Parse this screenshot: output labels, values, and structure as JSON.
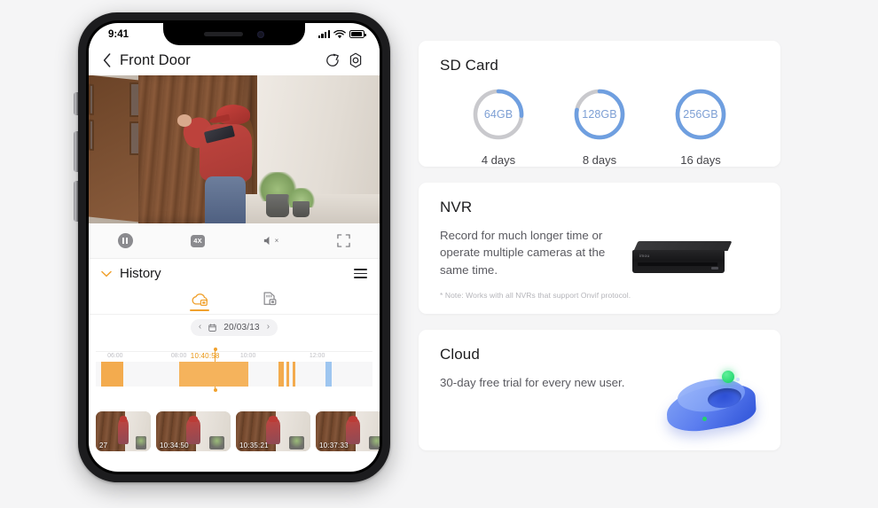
{
  "phone": {
    "status_bar": {
      "time": "9:41",
      "signal_icon": "cellular-bars-icon",
      "wifi_icon": "wifi-icon",
      "battery_icon": "battery-icon"
    },
    "header": {
      "back_icon": "chevron-left-icon",
      "title": "Front Door",
      "share_icon": "share-icon",
      "settings_icon": "settings-gear-icon"
    },
    "video": {
      "scene_description": "Front door camera live view",
      "person": "delivery person at wooden door"
    },
    "controls": [
      {
        "name": "pause-button",
        "icon": "pause-icon",
        "label": ""
      },
      {
        "name": "playback-speed-button",
        "icon": "speed-badge-icon",
        "label": "4X"
      },
      {
        "name": "mute-button",
        "icon": "speaker-mute-icon",
        "label": "×"
      },
      {
        "name": "fullscreen-button",
        "icon": "fullscreen-icon",
        "label": ""
      }
    ],
    "history": {
      "chevron_icon": "chevron-down-icon",
      "title": "History",
      "menu_icon": "hamburger-menu-icon",
      "tabs": [
        {
          "name": "cloud-storage-tab",
          "icon": "cloud-video-icon",
          "active": true
        },
        {
          "name": "sd-card-tab",
          "icon": "sd-card-video-icon",
          "active": false
        }
      ],
      "date_nav": {
        "prev_icon": "chevron-left-icon",
        "calendar_icon": "calendar-icon",
        "date": "20/03/13",
        "next_icon": "chevron-right-icon"
      },
      "timeline": {
        "playhead_time": "10:40:58",
        "playhead_pct": 43,
        "axis_labels": [
          {
            "text": "06:00",
            "pct": 7
          },
          {
            "text": "08:00",
            "pct": 30
          },
          {
            "text": "10:00",
            "pct": 55
          },
          {
            "text": "12:00",
            "pct": 80
          }
        ],
        "blocks": [
          {
            "start_pct": 2,
            "width_pct": 8,
            "color": "#f3ab4e"
          },
          {
            "start_pct": 30,
            "width_pct": 25,
            "color": "#f5b35c"
          },
          {
            "start_pct": 66,
            "width_pct": 2,
            "color": "#f3ab4e"
          },
          {
            "start_pct": 69,
            "width_pct": 0.8,
            "color": "#f3ab4e"
          },
          {
            "start_pct": 71,
            "width_pct": 1.2,
            "color": "#f3ab4e"
          },
          {
            "start_pct": 83,
            "width_pct": 2.2,
            "color": "#9ec6f0"
          }
        ]
      },
      "thumbnails": [
        {
          "time": "27",
          "partial": true
        },
        {
          "time": "10:34:50",
          "partial": false
        },
        {
          "time": "10:35:21",
          "partial": false
        },
        {
          "time": "10:37:33",
          "partial": false
        }
      ]
    }
  },
  "cards": {
    "sd_card": {
      "title": "SD Card",
      "options": [
        {
          "capacity": "64GB",
          "days": "4 days",
          "fill_pct": 26
        },
        {
          "capacity": "128GB",
          "days": "8 days",
          "fill_pct": 78
        },
        {
          "capacity": "256GB",
          "days": "16 days",
          "fill_pct": 100
        }
      ],
      "ring_active_color": "#6f9fe0",
      "ring_track_color": "#c9c9cd",
      "capacity_text_color": "#7d9fd4"
    },
    "nvr": {
      "title": "NVR",
      "description": "Record for much longer time or operate multiple cameras at the same time.",
      "note": "* Note: Works with all NVRs that support Onvif protocol.",
      "device_icon": "nvr-device-image",
      "device_brand": "imou"
    },
    "cloud": {
      "title": "Cloud",
      "description": "30-day free trial for every new user.",
      "art_icon": "cloud-3d-illustration"
    }
  },
  "theme": {
    "page_background": "#f5f5f6",
    "card_background": "#ffffff",
    "accent_orange": "#f0a12e",
    "accent_blue": "#6f9fe0"
  }
}
